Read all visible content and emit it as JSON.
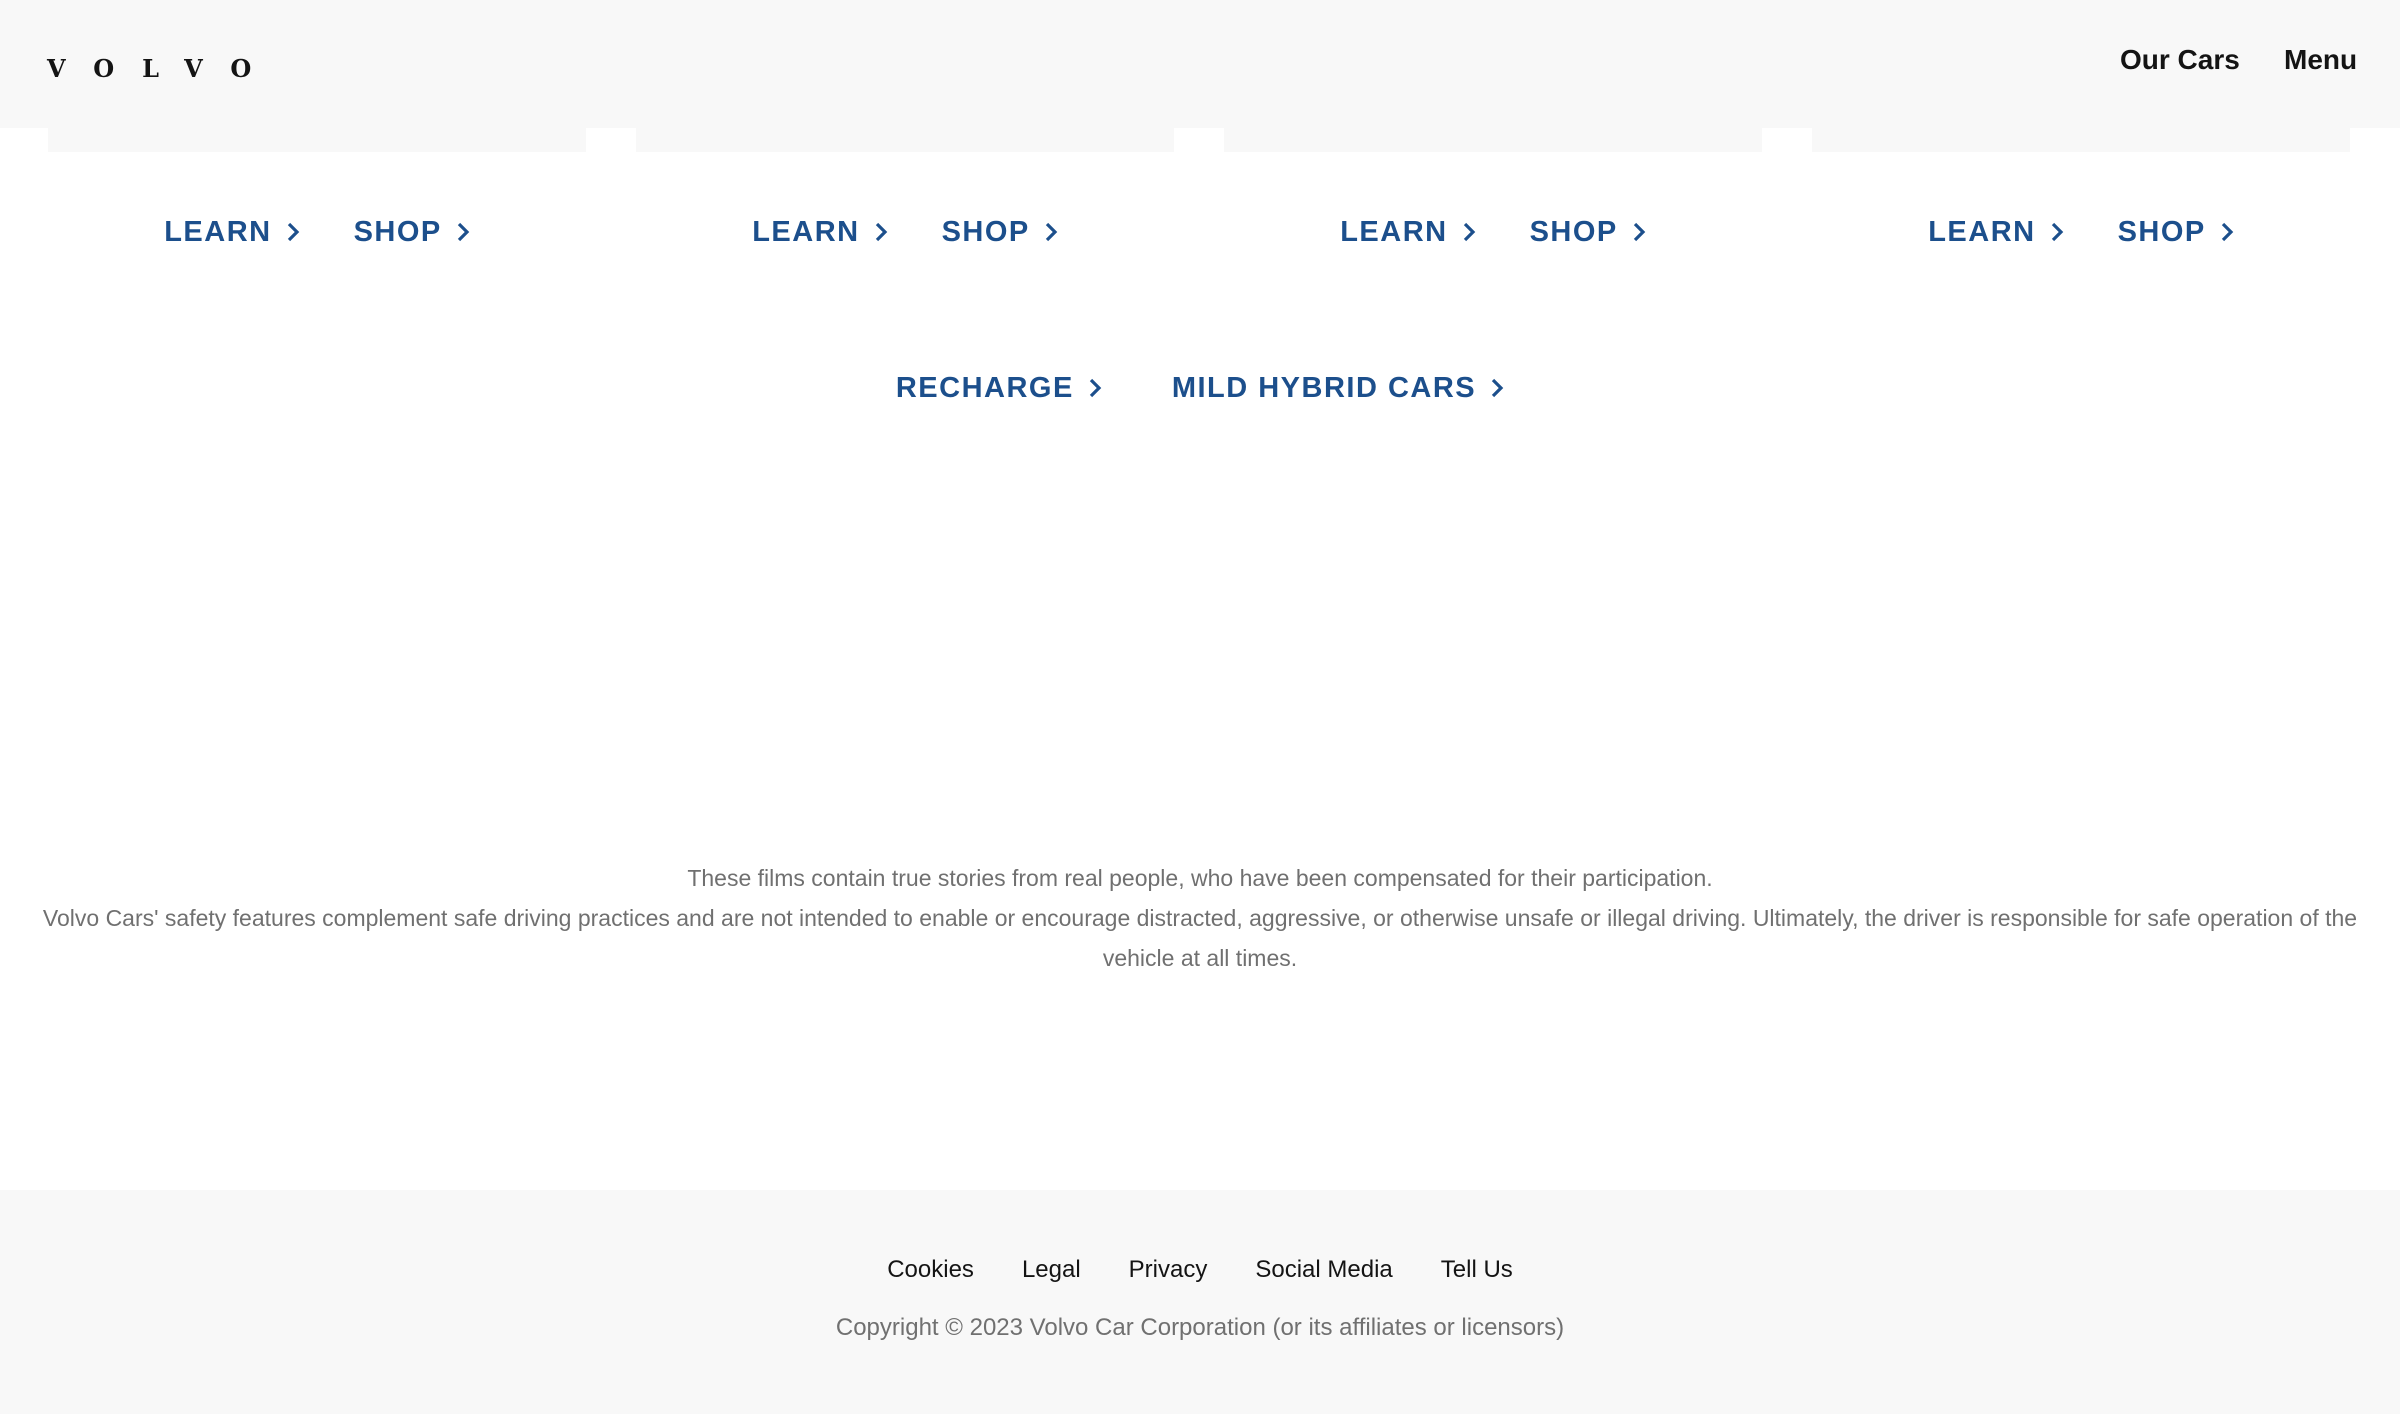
{
  "header": {
    "logo_text": "VOLVO",
    "nav": {
      "our_cars": "Our Cars",
      "menu": "Menu"
    }
  },
  "cards": [
    {
      "learn": "LEARN",
      "shop": "SHOP"
    },
    {
      "learn": "LEARN",
      "shop": "SHOP"
    },
    {
      "learn": "LEARN",
      "shop": "SHOP"
    },
    {
      "learn": "LEARN",
      "shop": "SHOP"
    }
  ],
  "links": {
    "recharge": "RECHARGE",
    "mild_hybrid": "MILD HYBRID CARS"
  },
  "disclaimer": {
    "line1": "These films contain true stories from real people, who have been compensated for their participation.",
    "line2": "Volvo Cars' safety features complement safe driving practices and are not intended to enable or encourage distracted, aggressive, or otherwise unsafe or illegal driving. Ultimately, the driver is responsible for safe operation of the vehicle at all times."
  },
  "footer": {
    "links": [
      "Cookies",
      "Legal",
      "Privacy",
      "Social Media",
      "Tell Us"
    ],
    "copyright": "Copyright © 2023 Volvo Car Corporation (or its affiliates or licensors)"
  },
  "icons": {
    "chevron": "chevron-right-icon"
  },
  "colors": {
    "link_blue": "#1c4f8c",
    "header_bg": "#f8f8f8",
    "muted_text": "#707070"
  }
}
